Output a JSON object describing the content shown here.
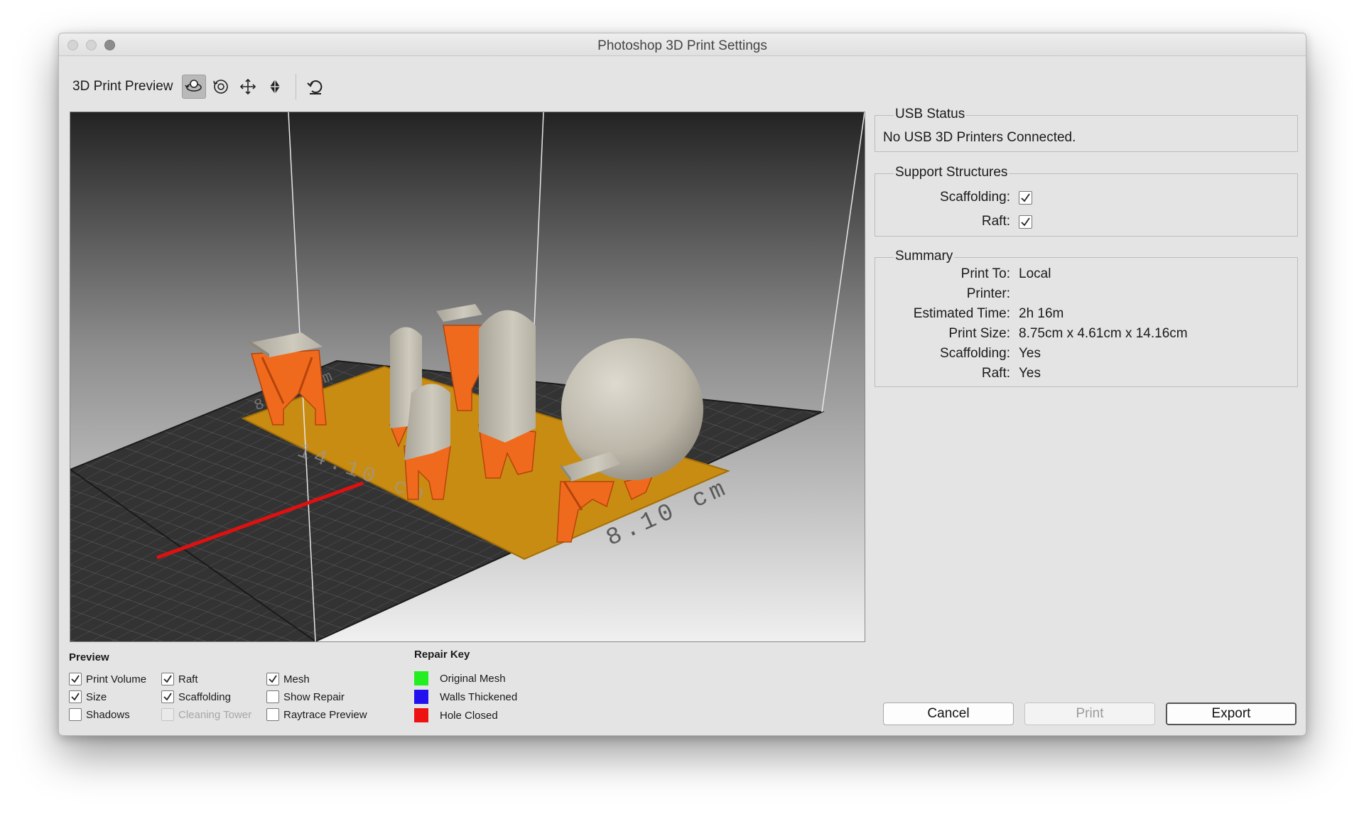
{
  "window": {
    "title": "Photoshop 3D Print Settings"
  },
  "toolbar": {
    "label": "3D Print Preview",
    "tools": [
      {
        "icon": "orbit-3d-icon",
        "active": true
      },
      {
        "icon": "roll-3d-icon",
        "active": false
      },
      {
        "icon": "pan-3d-icon",
        "active": false
      },
      {
        "icon": "slide-3d-icon",
        "active": false
      },
      {
        "icon": "reset-view-icon",
        "active": false
      }
    ]
  },
  "viewport": {
    "dim_front": "8.10 cm",
    "dim_left": "14.10 cm",
    "dim_back": "8.10 cm",
    "colors": {
      "plate": "#333333",
      "raft": "#c98c12",
      "support": "#f06a1e",
      "model": "#c8c3b6",
      "axis": "#e01010"
    }
  },
  "usb_status": {
    "title": "USB Status",
    "text": "No USB 3D Printers Connected."
  },
  "support_structures": {
    "title": "Support Structures",
    "items": [
      {
        "label": "Scaffolding:",
        "checked": true
      },
      {
        "label": "Raft:",
        "checked": true
      }
    ]
  },
  "summary": {
    "title": "Summary",
    "rows": [
      {
        "label": "Print To:",
        "value": "Local"
      },
      {
        "label": "Printer:",
        "value": ""
      },
      {
        "label": "Estimated Time:",
        "value": "2h 16m"
      },
      {
        "label": "Print Size:",
        "value": "8.75cm x 4.61cm x 14.16cm"
      },
      {
        "label": "Scaffolding:",
        "value": "Yes"
      },
      {
        "label": "Raft:",
        "value": "Yes"
      }
    ]
  },
  "preview": {
    "title": "Preview",
    "options": [
      {
        "label": "Print Volume",
        "checked": true,
        "enabled": true
      },
      {
        "label": "Size",
        "checked": true,
        "enabled": true
      },
      {
        "label": "Shadows",
        "checked": false,
        "enabled": true
      },
      {
        "label": "Raft",
        "checked": true,
        "enabled": true
      },
      {
        "label": "Scaffolding",
        "checked": true,
        "enabled": true
      },
      {
        "label": "Cleaning Tower",
        "checked": false,
        "enabled": false
      },
      {
        "label": "Mesh",
        "checked": true,
        "enabled": true
      },
      {
        "label": "Show Repair",
        "checked": false,
        "enabled": true
      },
      {
        "label": "Raytrace Preview",
        "checked": false,
        "enabled": true
      }
    ]
  },
  "repair_key": {
    "title": "Repair Key",
    "items": [
      {
        "label": "Original Mesh",
        "color": "#22ee22"
      },
      {
        "label": "Walls Thickened",
        "color": "#2211ee"
      },
      {
        "label": "Hole Closed",
        "color": "#ee1111"
      }
    ]
  },
  "buttons": {
    "cancel": "Cancel",
    "print": "Print",
    "export": "Export"
  }
}
